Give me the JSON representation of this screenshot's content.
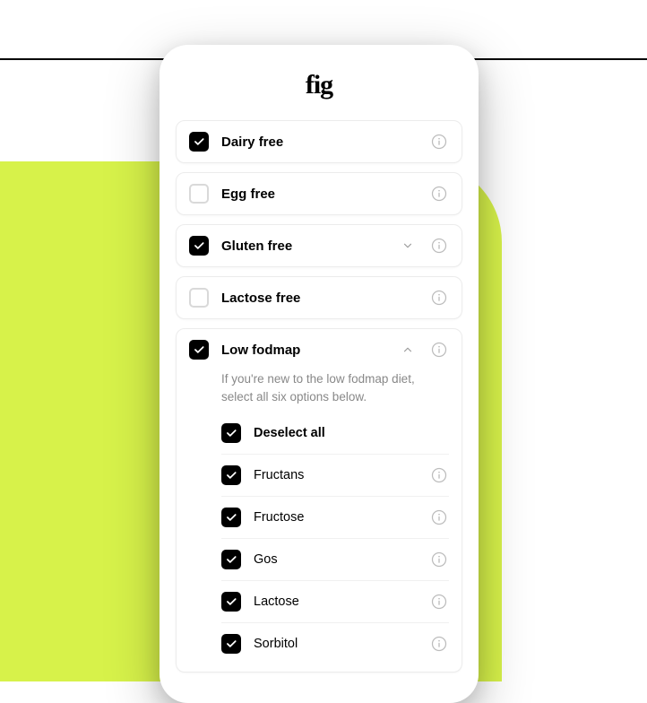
{
  "logo": "fig",
  "items": [
    {
      "label": "Dairy free",
      "checked": true,
      "expandable": false
    },
    {
      "label": "Egg free",
      "checked": false,
      "expandable": false
    },
    {
      "label": "Gluten free",
      "checked": true,
      "expandable": true,
      "expanded": false
    },
    {
      "label": "Lactose free",
      "checked": false,
      "expandable": false
    },
    {
      "label": "Low fodmap",
      "checked": true,
      "expandable": true,
      "expanded": true,
      "hint": "If you're new to the low fodmap diet, select all six options below.",
      "deselect_label": "Deselect all",
      "sub": [
        {
          "label": "Fructans",
          "checked": true
        },
        {
          "label": "Fructose",
          "checked": true
        },
        {
          "label": "Gos",
          "checked": true
        },
        {
          "label": "Lactose",
          "checked": true
        },
        {
          "label": "Sorbitol",
          "checked": true
        }
      ]
    }
  ]
}
